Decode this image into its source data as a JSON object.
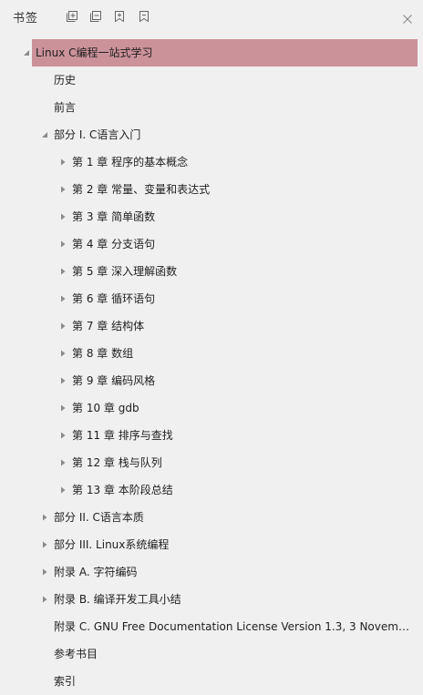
{
  "header": {
    "title": "书签",
    "tools": [
      {
        "name": "expand-all-icon"
      },
      {
        "name": "collapse-all-icon"
      },
      {
        "name": "add-bookmark-icon"
      },
      {
        "name": "bookmark-options-icon"
      }
    ],
    "close_icon": "close-icon"
  },
  "tree": [
    {
      "label": "Linux C编程一站式学习",
      "level": 0,
      "arrow": "expanded",
      "selected": true
    },
    {
      "label": "历史",
      "level": 1,
      "arrow": "none"
    },
    {
      "label": "前言",
      "level": 1,
      "arrow": "none"
    },
    {
      "label": "部分 I. C语言入门",
      "level": 1,
      "arrow": "expanded"
    },
    {
      "label": "第 1 章 程序的基本概念",
      "level": 2,
      "arrow": "collapsed"
    },
    {
      "label": "第 2 章 常量、变量和表达式",
      "level": 2,
      "arrow": "collapsed"
    },
    {
      "label": "第 3 章 简单函数",
      "level": 2,
      "arrow": "collapsed"
    },
    {
      "label": "第 4 章 分支语句",
      "level": 2,
      "arrow": "collapsed"
    },
    {
      "label": "第 5 章 深入理解函数",
      "level": 2,
      "arrow": "collapsed"
    },
    {
      "label": "第 6 章 循环语句",
      "level": 2,
      "arrow": "collapsed"
    },
    {
      "label": "第 7 章 结构体",
      "level": 2,
      "arrow": "collapsed"
    },
    {
      "label": "第 8 章 数组",
      "level": 2,
      "arrow": "collapsed"
    },
    {
      "label": "第 9 章 编码风格",
      "level": 2,
      "arrow": "collapsed"
    },
    {
      "label": "第 10 章 gdb",
      "level": 2,
      "arrow": "collapsed"
    },
    {
      "label": "第 11 章 排序与查找",
      "level": 2,
      "arrow": "collapsed"
    },
    {
      "label": "第 12 章 栈与队列",
      "level": 2,
      "arrow": "collapsed"
    },
    {
      "label": "第 13 章 本阶段总结",
      "level": 2,
      "arrow": "collapsed"
    },
    {
      "label": "部分 II. C语言本质",
      "level": 1,
      "arrow": "collapsed"
    },
    {
      "label": "部分 III. Linux系统编程",
      "level": 1,
      "arrow": "collapsed"
    },
    {
      "label": "附录 A. 字符编码",
      "level": 1,
      "arrow": "collapsed"
    },
    {
      "label": "附录 B. 编译开发工具小结",
      "level": 1,
      "arrow": "collapsed"
    },
    {
      "label": "附录 C. GNU Free Documentation License Version 1.3, 3 Novembe...",
      "level": 1,
      "arrow": "none"
    },
    {
      "label": "参考书目",
      "level": 1,
      "arrow": "none"
    },
    {
      "label": "索引",
      "level": 1,
      "arrow": "none"
    }
  ],
  "colors": {
    "selected_bg": "#cc929a",
    "panel_bg": "#f0f0f0",
    "arrow": "#8a8a8a"
  }
}
